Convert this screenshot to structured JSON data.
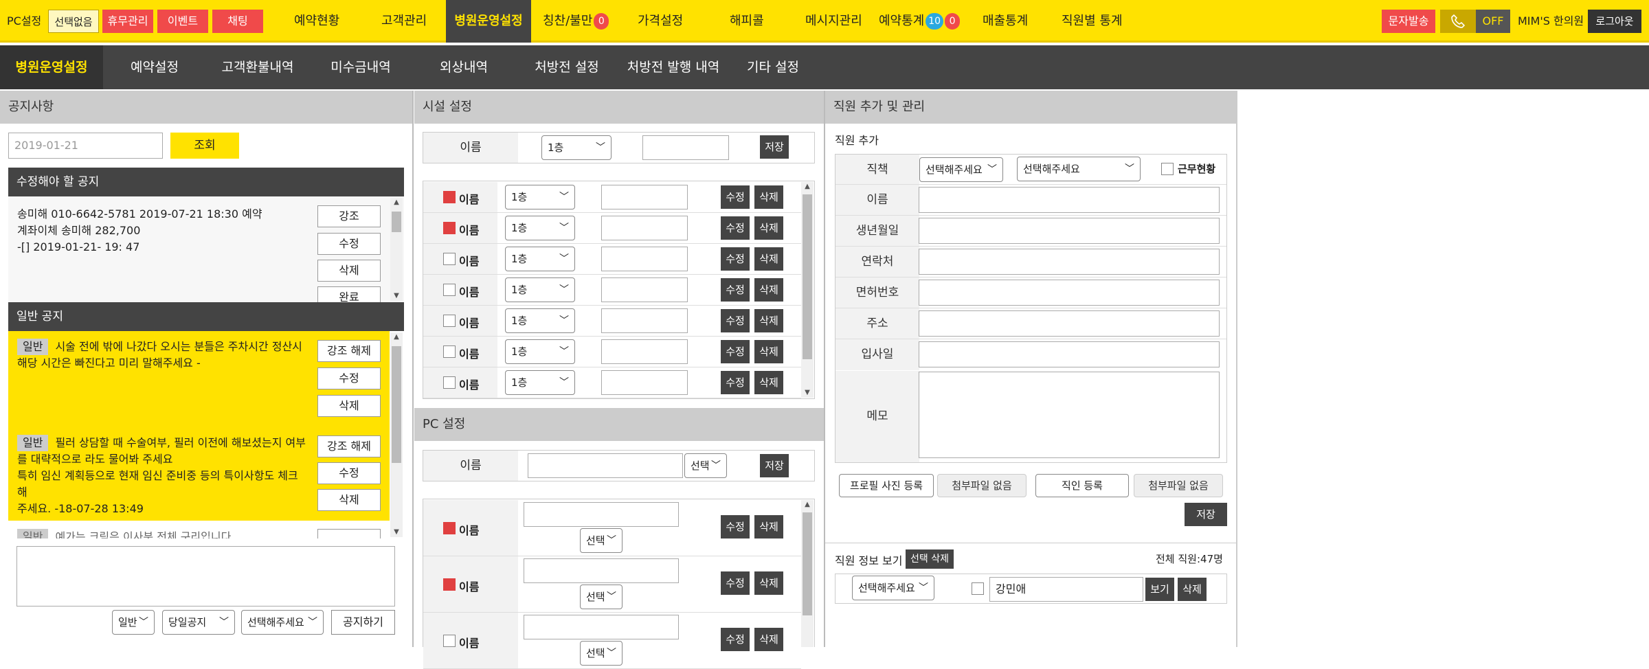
{
  "topbar": {
    "pc_setting": "PC설정",
    "none_selected": "선택없음",
    "holiday": "휴무관리",
    "event": "이벤트",
    "chat": "채팅",
    "nav": [
      "예약현황",
      "고객관리",
      "병원운영설정",
      "칭찬/불만",
      "가격설정",
      "해피콜",
      "메시지관리",
      "예약통계",
      "매출통계",
      "직원별 통계"
    ],
    "praise_badge": "0",
    "stats_badge1": "10",
    "stats_badge2": "0",
    "sms": "문자발송",
    "off": "OFF",
    "clinic": "MIM'S 한의원",
    "logout": "로그아웃"
  },
  "subnav": [
    "병원운영설정",
    "예약설정",
    "고객환불내역",
    "미수금내역",
    "외상내역",
    "처방전 설정",
    "처방전 발행 내역",
    "기타 설정"
  ],
  "notice": {
    "title": "공지사항",
    "date_value": "2019-01-21",
    "search": "조회",
    "edit_title": "수정해야 할 공지",
    "edit_lines": [
      "송미해 010-6642-5781 2019-07-21 18:30 예약",
      "계좌이체 송미해 282,700",
      "-[] 2019-01-21- 19: 47"
    ],
    "edit_buttons": [
      "강조",
      "수정",
      "삭제",
      "완료"
    ],
    "general_title": "일반 공지",
    "items": [
      {
        "tag": "일반",
        "lines": [
          "시술 전에 밖에 나갔다 오시는 분들은 주차시간 정산시",
          "해당 시간은 빠진다고 미리 말해주세요 -"
        ]
      },
      {
        "tag": "일반",
        "lines": [
          "필러 상담할 때 수술여부, 필러 이전에 해보셨는지 여부",
          "를 대략적으로 라도 물어봐 주세요",
          "특히 임신 계획등으로 현재 임신 준비중 등의 특이사항도 체크해",
          "주세요. -18-07-28 13:49"
        ]
      },
      {
        "tag": "일반",
        "lines": [
          "예가는 크림은 이사분 전체 구리입니다"
        ]
      }
    ],
    "item_buttons": [
      "강조 해제",
      "수정",
      "삭제"
    ],
    "type_select": "일반",
    "day_select": "당일공지",
    "who_select": "선택해주세요",
    "post": "공지하기"
  },
  "facility": {
    "title": "시설 설정",
    "name_label": "이름",
    "floor": "1층",
    "save": "저장",
    "rows": [
      {
        "checked": true
      },
      {
        "checked": true
      },
      {
        "checked": false
      },
      {
        "checked": false
      },
      {
        "checked": false
      },
      {
        "checked": false
      },
      {
        "checked": false
      }
    ],
    "row_label": "이름",
    "edit": "수정",
    "del": "삭제"
  },
  "pc": {
    "title": "PC 설정",
    "name_label": "이름",
    "select": "선택",
    "save": "저장",
    "rows": [
      {
        "checked": true
      },
      {
        "checked": true
      },
      {
        "checked": false
      }
    ],
    "row_label": "이름",
    "edit": "수정",
    "del": "삭제"
  },
  "staff": {
    "title": "직원 추가 및 관리",
    "add": "직원 추가",
    "position": "직책",
    "sel1": "선택해주세요",
    "sel2": "선택해주세요",
    "working": "근무현황",
    "fields": [
      "이름",
      "생년월일",
      "연락처",
      "면허번호",
      "주소",
      "입사일"
    ],
    "memo": "메모",
    "photo_btn": "프로필 사진 등록",
    "no_file": "첨부파일 없음",
    "seal_btn": "직인 등록",
    "no_file2": "첨부파일 없음",
    "save": "저장",
    "view_title": "직원 정보 보기",
    "select_delete": "선택 삭제",
    "total": "전체 직원:47명",
    "list_select": "선택해주세요",
    "member": "강민애",
    "view": "보기",
    "del": "삭제"
  },
  "colors": {
    "yellow": "#ffe200",
    "red": "#f04a4a",
    "dark": "#444444"
  }
}
